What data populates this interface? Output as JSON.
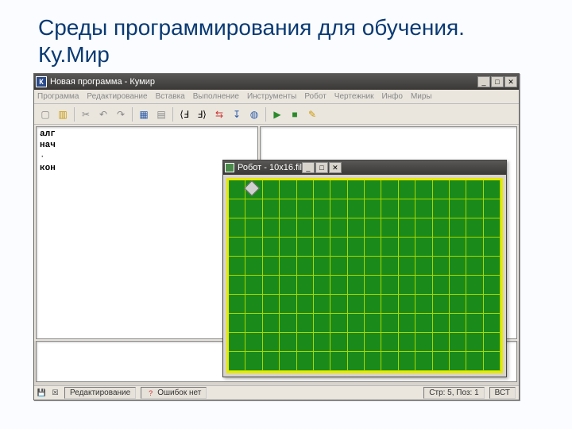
{
  "slide": {
    "title": "Среды программирования для обучения. Ку.Мир"
  },
  "main_window": {
    "app_icon_letter": "К",
    "title": "Новая программа - Кумир",
    "menu": [
      "Программа",
      "Редактирование",
      "Вставка",
      "Выполнение",
      "Инструменты",
      "Робот",
      "Чертежник",
      "Инфо",
      "Миры"
    ],
    "toolbar_icons": [
      "new",
      "open",
      "cut",
      "undo",
      "redo",
      "table",
      "grid",
      "brace-l",
      "brace-r",
      "arrows",
      "step",
      "globe",
      "run-green",
      "stop",
      "edit"
    ],
    "code": {
      "l1": "алг",
      "l2": "нач",
      "l3": "·",
      "l4": "кон"
    },
    "status": {
      "mode": "Редактирование",
      "errors": "Ошибок нет",
      "pos": "Стр: 5, Поз: 1",
      "ins": "ВСТ"
    }
  },
  "robot_window": {
    "title": "Робот - 10х16.fil",
    "cols": 16,
    "rows": 10
  }
}
